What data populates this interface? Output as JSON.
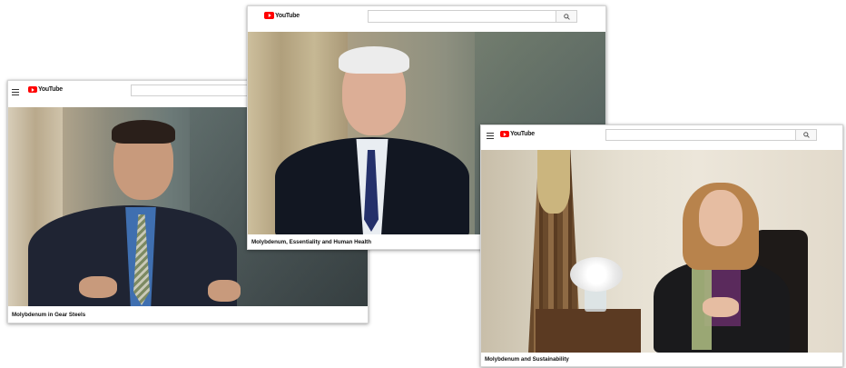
{
  "windows": [
    {
      "id": "w1",
      "brand": "YouTube",
      "search": {
        "placeholder": ""
      },
      "video_title": "Molybdenum in Gear Steels"
    },
    {
      "id": "w2",
      "brand": "YouTube",
      "search": {
        "placeholder": "",
        "button_icon": "search-icon"
      },
      "video_title": "Molybdenum, Essentiality and Human Health"
    },
    {
      "id": "w3",
      "brand": "YouTube",
      "search": {
        "placeholder": "",
        "button_icon": "search-icon"
      },
      "video_title": "Molybdenum and Sustainability"
    }
  ],
  "colors": {
    "brand_red": "#ff0000",
    "window_bg": "#ffffff",
    "border": "#d6d6d6"
  }
}
